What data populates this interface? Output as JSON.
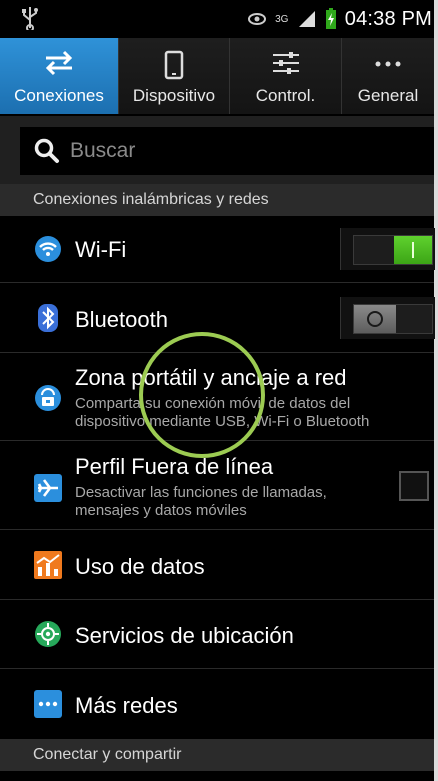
{
  "status_bar": {
    "time": "04:38 PM",
    "network": "3G",
    "icons": [
      "usb-icon",
      "eye-icon",
      "signal-icon",
      "battery-charging-icon"
    ]
  },
  "tabs": [
    {
      "label": "Conexiones",
      "icon": "arrows-swap-icon",
      "active": true
    },
    {
      "label": "Dispositivo",
      "icon": "phone-icon",
      "active": false
    },
    {
      "label": "Control.",
      "icon": "sliders-icon",
      "active": false
    },
    {
      "label": "General",
      "icon": "more-icon",
      "active": false
    }
  ],
  "search": {
    "placeholder": "Buscar"
  },
  "sections": {
    "wireless": "Conexiones inalámbricas y redes",
    "connect_share": "Conectar y compartir"
  },
  "rows": {
    "wifi": {
      "title": "Wi-Fi",
      "icon": "wifi-icon",
      "toggle": "on"
    },
    "bluetooth": {
      "title": "Bluetooth",
      "icon": "bluetooth-icon",
      "toggle": "off"
    },
    "hotspot": {
      "title": "Zona portátil y anclaje a red",
      "subtitle": "Comparta su conexión móvil de datos del dispositivo mediante USB, Wi-Fi o Bluetooth",
      "icon": "hotspot-icon"
    },
    "airplane": {
      "title": "Perfil Fuera de línea",
      "subtitle": "Desactivar las funciones de llamadas, mensajes y datos móviles",
      "icon": "airplane-icon",
      "checked": false
    },
    "data_usage": {
      "title": "Uso de datos",
      "icon": "chart-icon"
    },
    "location": {
      "title": "Servicios de ubicación",
      "icon": "location-icon"
    },
    "more_networks": {
      "title": "Más redes",
      "icon": "more-networks-icon"
    }
  },
  "colors": {
    "accent_blue": "#2a8ad4",
    "toggle_on": "#4cbc1f",
    "annotation_circle": "#9ccb52"
  }
}
